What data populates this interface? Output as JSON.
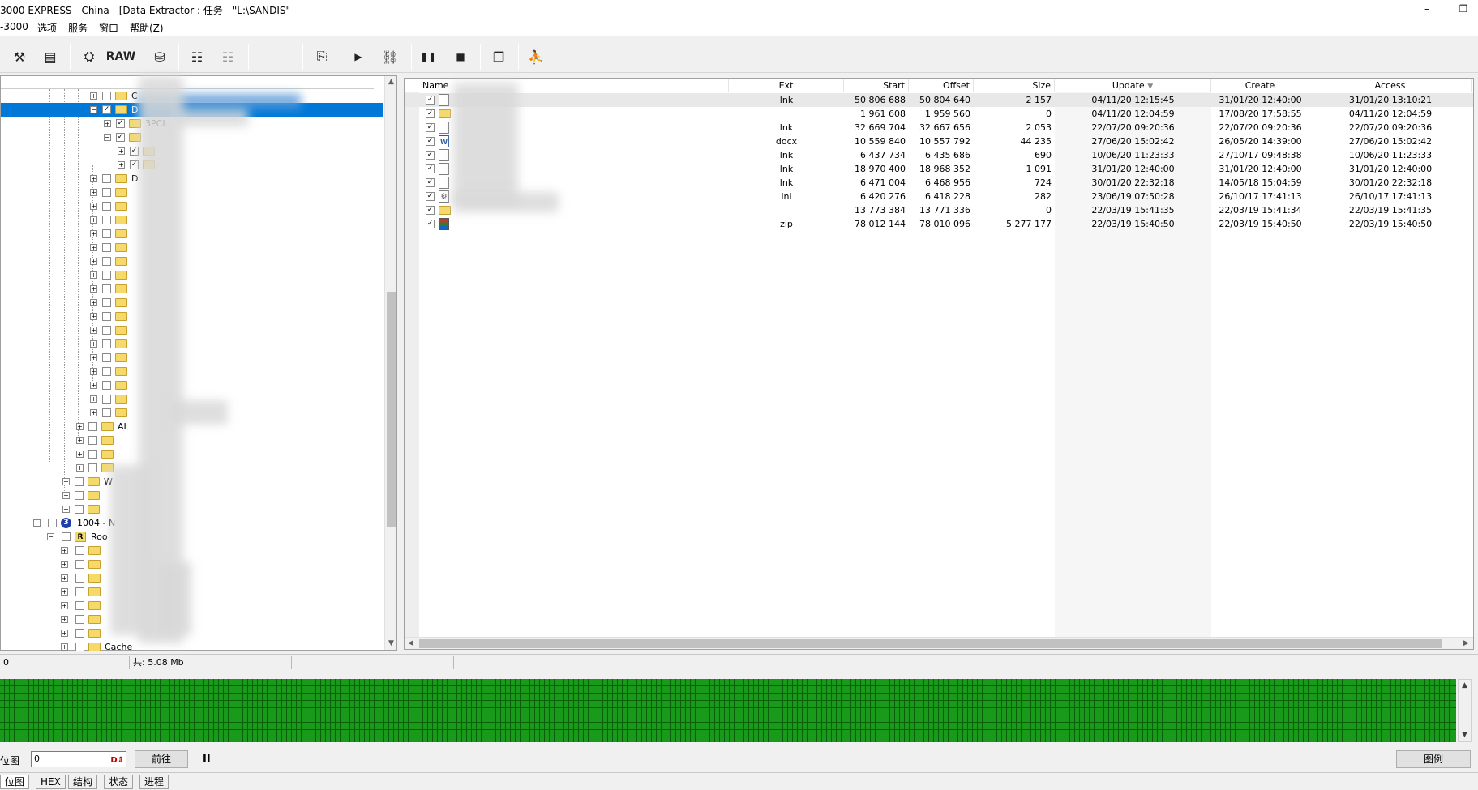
{
  "window": {
    "title": "3000 EXPRESS - China - [Data Extractor : 任务 - \"L:\\SANDIS\"",
    "restore_glyph": "❐",
    "minimize_glyph": "–"
  },
  "menu": [
    "-3000",
    "选项",
    "服务",
    "窗口",
    "帮助(Z)"
  ],
  "toolbar": {
    "raw_label": "RAW",
    "icons": [
      "tools-icon",
      "scroll-icon",
      "binoculars-icon",
      "raw-button",
      "disk-icon",
      "list-tree-icon",
      "list-tree-disabled-icon",
      "export-icon",
      "play-icon",
      "network-icon",
      "pause-icon",
      "stop-icon",
      "copy-windows-icon",
      "exit-icon"
    ]
  },
  "tree": {
    "rows": [
      {
        "label": "C",
        "indent": 1,
        "exp": "+",
        "checked": false
      },
      {
        "label": "D",
        "indent": 1,
        "exp": "−",
        "checked": true,
        "selected": true
      },
      {
        "label": "3PCI",
        "indent": 2,
        "exp": "+",
        "checked": true
      },
      {
        "label": "",
        "indent": 2,
        "exp": "−",
        "checked": true
      },
      {
        "label": "",
        "indent": 3,
        "exp": "+",
        "checked": true
      },
      {
        "label": "",
        "indent": 3,
        "exp": "+",
        "checked": true
      },
      {
        "label": "D",
        "indent": 1,
        "exp": "+",
        "checked": false
      },
      {
        "label": "",
        "indent": 1,
        "exp": "+",
        "checked": false
      },
      {
        "label": "",
        "indent": 1,
        "exp": "+",
        "checked": false
      },
      {
        "label": "",
        "indent": 1,
        "exp": "+",
        "checked": false
      },
      {
        "label": "",
        "indent": 1,
        "exp": "+",
        "checked": false
      },
      {
        "label": "",
        "indent": 1,
        "exp": "+",
        "checked": false
      },
      {
        "label": "",
        "indent": 1,
        "exp": "+",
        "checked": false
      },
      {
        "label": "",
        "indent": 1,
        "exp": "+",
        "checked": false
      },
      {
        "label": "",
        "indent": 1,
        "exp": "+",
        "checked": false
      },
      {
        "label": "",
        "indent": 1,
        "exp": "+",
        "checked": false
      },
      {
        "label": "",
        "indent": 1,
        "exp": "+",
        "checked": false
      },
      {
        "label": "",
        "indent": 1,
        "exp": "+",
        "checked": false
      },
      {
        "label": "",
        "indent": 1,
        "exp": "+",
        "checked": false
      },
      {
        "label": "",
        "indent": 1,
        "exp": "+",
        "checked": false
      },
      {
        "label": "",
        "indent": 1,
        "exp": "+",
        "checked": false
      },
      {
        "label": "",
        "indent": 1,
        "exp": "+",
        "checked": false
      },
      {
        "label": "",
        "indent": 1,
        "exp": "+",
        "checked": false
      },
      {
        "label": "",
        "indent": 1,
        "exp": "+",
        "checked": false
      },
      {
        "label": "AI",
        "indent": 0,
        "exp": "+",
        "checked": false
      },
      {
        "label": "",
        "indent": 0,
        "exp": "+",
        "checked": false
      },
      {
        "label": "",
        "indent": 0,
        "exp": "+",
        "checked": false
      },
      {
        "label": "",
        "indent": 0,
        "exp": "+",
        "checked": false
      },
      {
        "label": "W",
        "indent": -1,
        "exp": "+",
        "checked": false
      },
      {
        "label": "",
        "indent": -1,
        "exp": "+",
        "checked": false
      },
      {
        "label": "",
        "indent": -1,
        "exp": "+",
        "checked": false
      }
    ],
    "disk_label": "1004 - N",
    "disk_badge": "3",
    "root_label": "Roo",
    "root_badge": "R",
    "root_children": [
      "",
      "",
      "",
      "",
      "",
      "",
      "",
      "Cache"
    ]
  },
  "files": {
    "columns": [
      "Name",
      "Ext",
      "Start",
      "Offset",
      "Size",
      "Update",
      "Create",
      "Access"
    ],
    "sort_glyph": "▼",
    "rows": [
      {
        "icon": "doc",
        "ext": "lnk",
        "start": "50 806 688",
        "offset": "50 804 640",
        "size": "2 157",
        "update": "04/11/20 12:15:45",
        "create": "31/01/20 12:40:00",
        "access": "31/01/20 13:10:21"
      },
      {
        "icon": "folder",
        "ext": "",
        "start": "1 961 608",
        "offset": "1 959 560",
        "size": "0",
        "update": "04/11/20 12:04:59",
        "create": "17/08/20 17:58:55",
        "access": "04/11/20 12:04:59"
      },
      {
        "icon": "doc",
        "ext": "lnk",
        "start": "32 669 704",
        "offset": "32 667 656",
        "size": "2 053",
        "update": "22/07/20 09:20:36",
        "create": "22/07/20 09:20:36",
        "access": "22/07/20 09:20:36"
      },
      {
        "icon": "word",
        "ext": "docx",
        "start": "10 559 840",
        "offset": "10 557 792",
        "size": "44 235",
        "update": "27/06/20 15:02:42",
        "create": "26/05/20 14:39:00",
        "access": "27/06/20 15:02:42"
      },
      {
        "icon": "doc",
        "ext": "lnk",
        "start": "6 437 734",
        "offset": "6 435 686",
        "size": "690",
        "update": "10/06/20 11:23:33",
        "create": "27/10/17 09:48:38",
        "access": "10/06/20 11:23:33"
      },
      {
        "icon": "doc",
        "ext": "lnk",
        "start": "18 970 400",
        "offset": "18 968 352",
        "size": "1 091",
        "update": "31/01/20 12:40:00",
        "create": "31/01/20 12:40:00",
        "access": "31/01/20 12:40:00"
      },
      {
        "icon": "doc",
        "ext": "lnk",
        "start": "6 471 004",
        "offset": "6 468 956",
        "size": "724",
        "update": "30/01/20 22:32:18",
        "create": "14/05/18 15:04:59",
        "access": "30/01/20 22:32:18"
      },
      {
        "icon": "ini",
        "ext": "ini",
        "start": "6 420 276",
        "offset": "6 418 228",
        "size": "282",
        "update": "23/06/19 07:50:28",
        "create": "26/10/17 17:41:13",
        "access": "26/10/17 17:41:13"
      },
      {
        "icon": "folder",
        "ext": "",
        "start": "13 773 384",
        "offset": "13 771 336",
        "size": "0",
        "update": "22/03/19 15:41:35",
        "create": "22/03/19 15:41:34",
        "access": "22/03/19 15:41:35"
      },
      {
        "icon": "zip",
        "ext": "zip",
        "start": "78 012 144",
        "offset": "78 010 096",
        "size": "5 277 177",
        "update": "22/03/19 15:40:50",
        "create": "22/03/19 15:40:50",
        "access": "22/03/19 15:40:50"
      }
    ]
  },
  "status": {
    "left": "0",
    "total": "共: 5.08 Mb"
  },
  "controls": {
    "bitmap_label": "位图",
    "input_value": "0",
    "forward_label": "前往",
    "pause_glyph": "II",
    "legend_label": "图例"
  },
  "tabs": [
    "位图",
    "HEX",
    "结构",
    "状态",
    "进程"
  ],
  "colors": {
    "selection": "#0078d7",
    "bitmap_green": "#22c722",
    "folder": "#f5d96b"
  }
}
